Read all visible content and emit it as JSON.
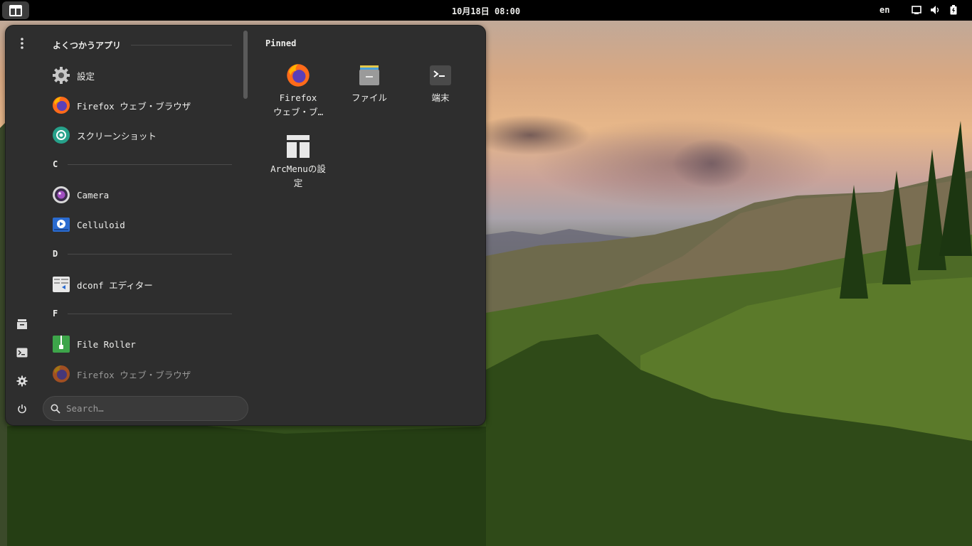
{
  "topbar": {
    "clock": "10月18日 08:00",
    "language": "en",
    "tray_icons": [
      "screen-icon",
      "volume-icon",
      "battery-icon"
    ]
  },
  "menu": {
    "frequent_header": "よくつかうアプリ",
    "frequent_apps": [
      {
        "label": "設定",
        "icon": "settings-gear-icon"
      },
      {
        "label": "Firefox ウェブ・ブラウザ",
        "icon": "firefox-icon"
      },
      {
        "label": "スクリーンショット",
        "icon": "screenshot-icon"
      }
    ],
    "sections": [
      {
        "letter": "C",
        "apps": [
          {
            "label": "Camera",
            "icon": "camera-icon"
          },
          {
            "label": "Celluloid",
            "icon": "celluloid-icon"
          }
        ]
      },
      {
        "letter": "D",
        "apps": [
          {
            "label": "dconf エディター",
            "icon": "dconf-editor-icon"
          }
        ]
      },
      {
        "letter": "F",
        "apps": [
          {
            "label": "File Roller",
            "icon": "file-roller-icon"
          },
          {
            "label": "Firefox ウェブ・ブラウザ",
            "icon": "firefox-icon"
          }
        ]
      }
    ],
    "pinned_title": "Pinned",
    "pinned": [
      {
        "line1": "Firefox",
        "line2": "ウェブ・ブ…",
        "icon": "firefox-icon"
      },
      {
        "line1": "ファイル",
        "line2": "",
        "icon": "files-icon"
      },
      {
        "line1": "端末",
        "line2": "",
        "icon": "terminal-icon"
      },
      {
        "line1": "ArcMenuの設",
        "line2": "定",
        "icon": "arcmenu-settings-icon"
      }
    ],
    "side_buttons": [
      "more-options-icon",
      "files-icon",
      "terminal-icon",
      "settings-icon",
      "power-icon"
    ],
    "search_placeholder": "Search…"
  },
  "colors": {
    "panel_bg": "#2e2e2e",
    "topbar_bg": "#000000",
    "text": "#eeeeec"
  }
}
